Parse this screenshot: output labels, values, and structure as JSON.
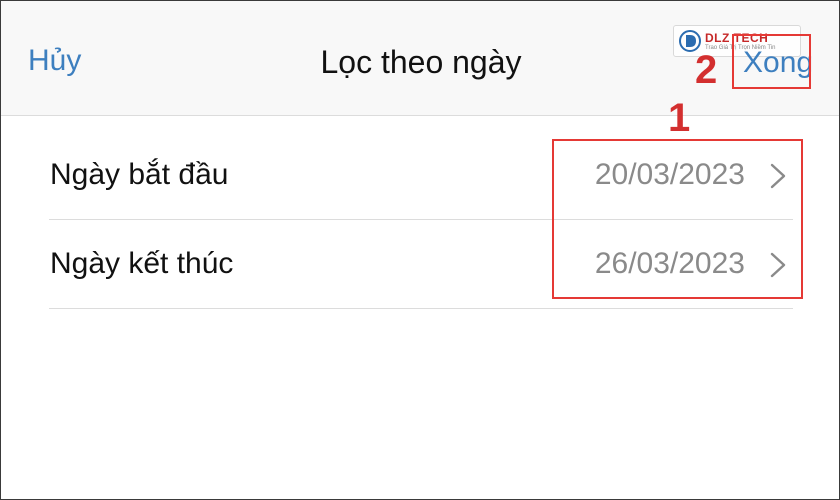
{
  "nav": {
    "cancel_label": "Hủy",
    "title": "Lọc theo ngày",
    "done_label": "Xong"
  },
  "filter_rows": [
    {
      "label": "Ngày bắt đầu",
      "value": "20/03/2023"
    },
    {
      "label": "Ngày kết thúc",
      "value": "26/03/2023"
    }
  ],
  "annotations": {
    "step_1": "1",
    "step_2": "2",
    "highlight_color": "#e53935"
  },
  "watermark": {
    "brand": "DLZ TECH",
    "tagline": "Trao Giá Trị Trọn Niềm Tin"
  },
  "colors": {
    "accent": "#3d7fbf",
    "label": "#111111",
    "value": "#8a8a8a",
    "navbar_bg": "#f8f8f8"
  },
  "icons": {
    "row_disclosure": "chevron-right-icon",
    "watermark_logo": "dlz-logo-icon"
  }
}
